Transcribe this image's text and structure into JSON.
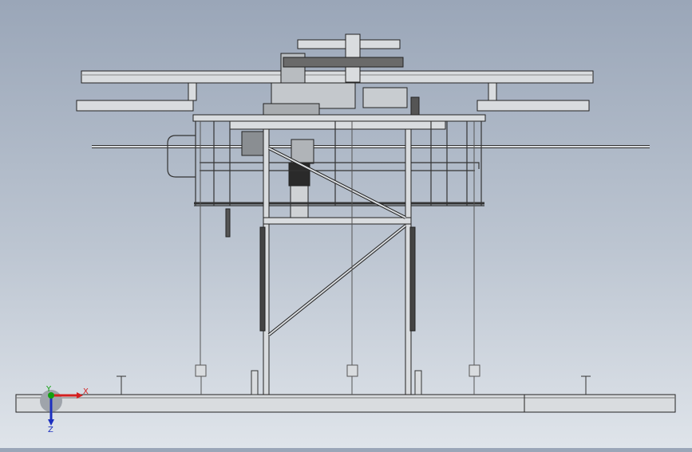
{
  "viewport": {
    "model": "frame-assembly"
  },
  "triad": {
    "x_label": "X",
    "y_label": "Y",
    "z_label": "Z",
    "x_color": "#d42020",
    "y_color": "#10a010",
    "z_color": "#1c2fbf"
  },
  "colors": {
    "background_top": "#9aa6b8",
    "background_bottom": "#dfe4ea",
    "steel": "#d9dcdf",
    "edge": "#222222",
    "dark_part": "#5a5a5a"
  }
}
